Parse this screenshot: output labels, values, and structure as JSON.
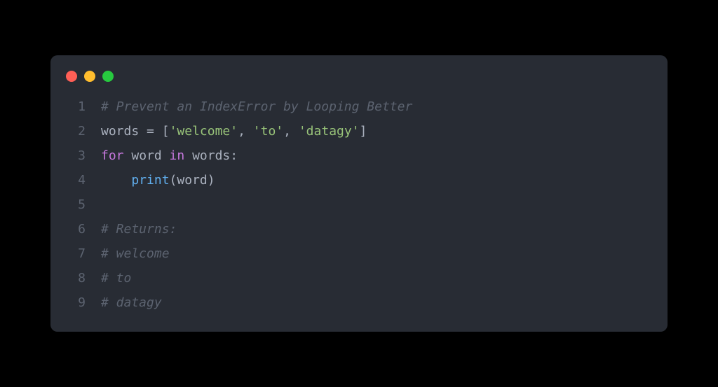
{
  "colors": {
    "background_page": "#000000",
    "background_editor": "#282c34",
    "traffic_red": "#ff5f56",
    "traffic_yellow": "#ffbd2e",
    "traffic_green": "#27c93f",
    "line_number": "#5c6370",
    "comment": "#5c6370",
    "identifier_red": "#e06c75",
    "default_text": "#abb2bf",
    "string": "#98c379",
    "keyword": "#c678dd",
    "function": "#61afef"
  },
  "code": {
    "lines": [
      {
        "num": "1",
        "tokens": [
          {
            "cls": "tok-comment",
            "text": "# Prevent an IndexError by Looping Better"
          }
        ]
      },
      {
        "num": "2",
        "tokens": [
          {
            "cls": "tok-var",
            "text": "words "
          },
          {
            "cls": "tok-op",
            "text": "="
          },
          {
            "cls": "tok-var",
            "text": " "
          },
          {
            "cls": "tok-punct",
            "text": "["
          },
          {
            "cls": "tok-string",
            "text": "'welcome'"
          },
          {
            "cls": "tok-punct",
            "text": ", "
          },
          {
            "cls": "tok-string",
            "text": "'to'"
          },
          {
            "cls": "tok-punct",
            "text": ", "
          },
          {
            "cls": "tok-string",
            "text": "'datagy'"
          },
          {
            "cls": "tok-punct",
            "text": "]"
          }
        ]
      },
      {
        "num": "3",
        "tokens": [
          {
            "cls": "tok-keyword",
            "text": "for"
          },
          {
            "cls": "tok-var",
            "text": " word "
          },
          {
            "cls": "tok-keyword",
            "text": "in"
          },
          {
            "cls": "tok-var",
            "text": " words"
          },
          {
            "cls": "tok-punct",
            "text": ":"
          }
        ]
      },
      {
        "num": "4",
        "tokens": [
          {
            "cls": "tok-var",
            "text": "    "
          },
          {
            "cls": "tok-func",
            "text": "print"
          },
          {
            "cls": "tok-punct",
            "text": "("
          },
          {
            "cls": "tok-var",
            "text": "word"
          },
          {
            "cls": "tok-punct",
            "text": ")"
          }
        ]
      },
      {
        "num": "5",
        "tokens": []
      },
      {
        "num": "6",
        "tokens": [
          {
            "cls": "tok-comment",
            "text": "# Returns:"
          }
        ]
      },
      {
        "num": "7",
        "tokens": [
          {
            "cls": "tok-comment",
            "text": "# welcome"
          }
        ]
      },
      {
        "num": "8",
        "tokens": [
          {
            "cls": "tok-comment",
            "text": "# to"
          }
        ]
      },
      {
        "num": "9",
        "tokens": [
          {
            "cls": "tok-comment",
            "text": "# datagy"
          }
        ]
      }
    ]
  }
}
